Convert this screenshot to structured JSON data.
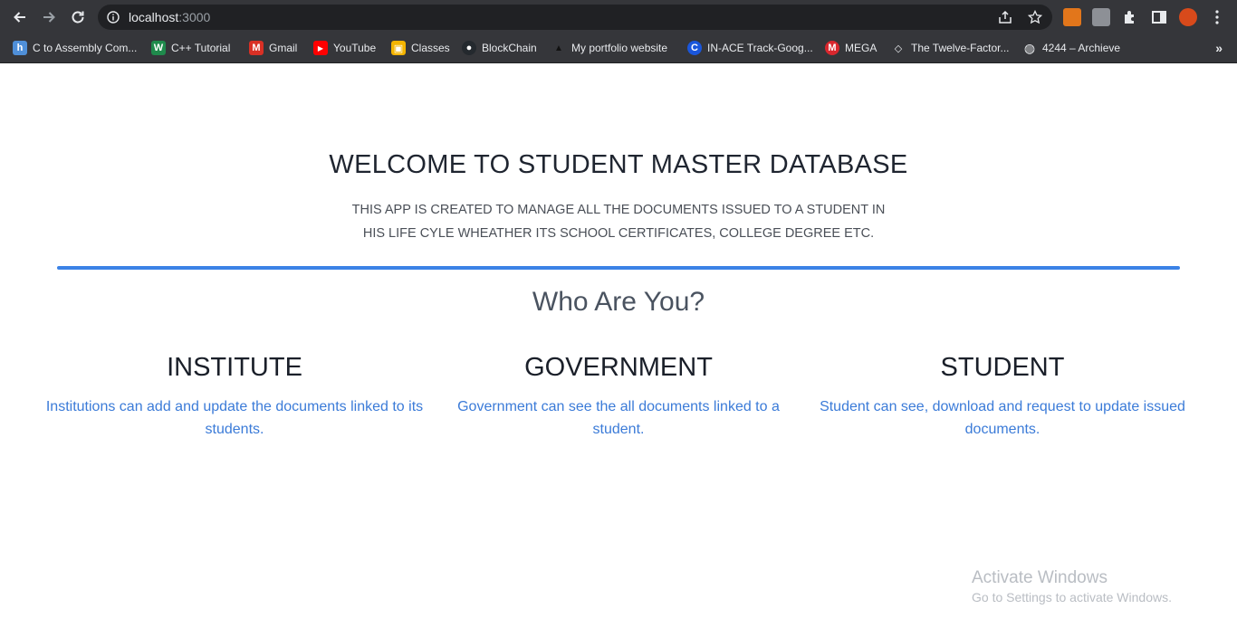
{
  "browser": {
    "url_host": "localhost",
    "url_port": ":3000"
  },
  "bookmarks": [
    {
      "label": "C to Assembly Com...",
      "icon": "h-icon",
      "color": "#4f8fd8",
      "glyph": "h"
    },
    {
      "label": "C++ Tutorial",
      "icon": "w3-icon",
      "color": "#1f8a4c",
      "glyph": "W"
    },
    {
      "label": "Gmail",
      "icon": "gmail-icon",
      "color": "#d93025",
      "glyph": "M"
    },
    {
      "label": "YouTube",
      "icon": "youtube-icon",
      "color": "#ff0000",
      "glyph": "▶"
    },
    {
      "label": "Classes",
      "icon": "classroom-icon",
      "color": "#f4b400",
      "glyph": "▣"
    },
    {
      "label": "BlockChain",
      "icon": "github-icon",
      "color": "#24292e",
      "glyph": "●"
    },
    {
      "label": "My portfolio website",
      "icon": "triangle-icon",
      "color": "#35363a",
      "glyph": "▲"
    },
    {
      "label": "IN-ACE Track-Goog...",
      "icon": "coursera-icon",
      "color": "#1a56db",
      "glyph": "C"
    },
    {
      "label": "MEGA",
      "icon": "mega-icon",
      "color": "#d9272e",
      "glyph": "M"
    },
    {
      "label": "The Twelve-Factor...",
      "icon": "diamond-icon",
      "color": "#35363a",
      "glyph": "◇"
    },
    {
      "label": "4244 – Archieve",
      "icon": "globe-icon",
      "color": "#35363a",
      "glyph": "◍"
    }
  ],
  "hero": {
    "title": "WELCOME TO STUDENT MASTER DATABASE",
    "description": "THIS APP IS CREATED TO MANAGE ALL THE DOCUMENTS ISSUED TO A STUDENT IN HIS LIFE CYLE WHEATHER ITS SCHOOL CERTIFICATES, COLLEGE DEGREE ETC."
  },
  "who": {
    "heading": "Who Are You?"
  },
  "roles": {
    "institute": {
      "title": "INSTITUTE",
      "desc": "Institutions can add and update the documents linked to its students."
    },
    "government": {
      "title": "GOVERNMENT",
      "desc": "Government can see the all documents linked to a student."
    },
    "student": {
      "title": "STUDENT",
      "desc": "Student can see, download and request to update issued documents."
    }
  },
  "watermark": {
    "line1": "Activate Windows",
    "line2": "Go to Settings to activate Windows."
  },
  "colors": {
    "accent": "#3b82e6",
    "link": "#3b7bd8"
  }
}
